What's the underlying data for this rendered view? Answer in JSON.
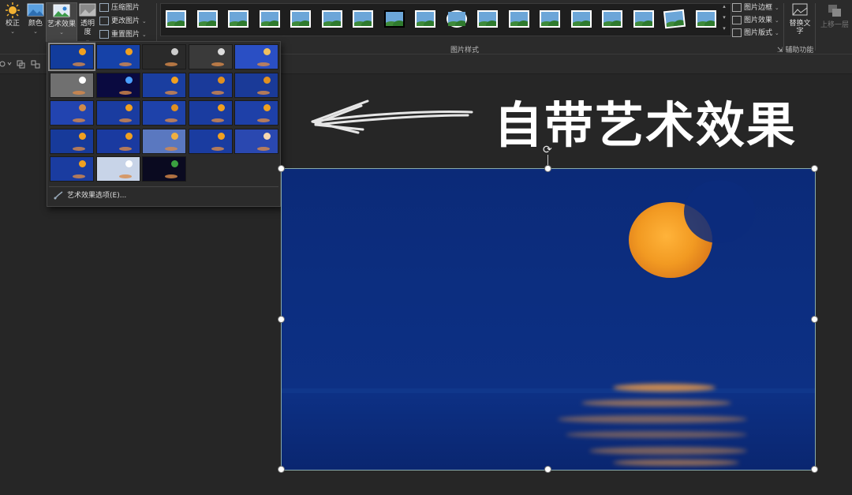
{
  "ribbon": {
    "buttons": [
      {
        "label": "校正",
        "icon": "sun-icon"
      },
      {
        "label": "颜色",
        "icon": "color-picture-icon"
      },
      {
        "label": "艺术效果",
        "icon": "art-effect-icon"
      },
      {
        "label": "透明度",
        "icon": "transparency-icon"
      }
    ],
    "adjust_cmds": [
      "压缩图片",
      "更改图片",
      "重置图片"
    ],
    "style_thumb_count": 18,
    "style_cmds": [
      "图片边框",
      "图片效果",
      "图片版式"
    ],
    "alt_text_label": "替换文字",
    "bring_forward_label": "上移一层",
    "group_picture_styles": "图片样式",
    "group_accessibility": "辅助功能"
  },
  "art_effects": {
    "option_label": "艺术效果选项(E)...",
    "thumb_count": 23,
    "selected_index": 0
  },
  "canvas": {
    "overlay_title": "自带艺术效果"
  },
  "colors": {
    "ribbon_bg": "#2b2b2b",
    "canvas_bg": "#262626",
    "picture_sky": "#0c2e80",
    "moon": "#f29a22"
  }
}
